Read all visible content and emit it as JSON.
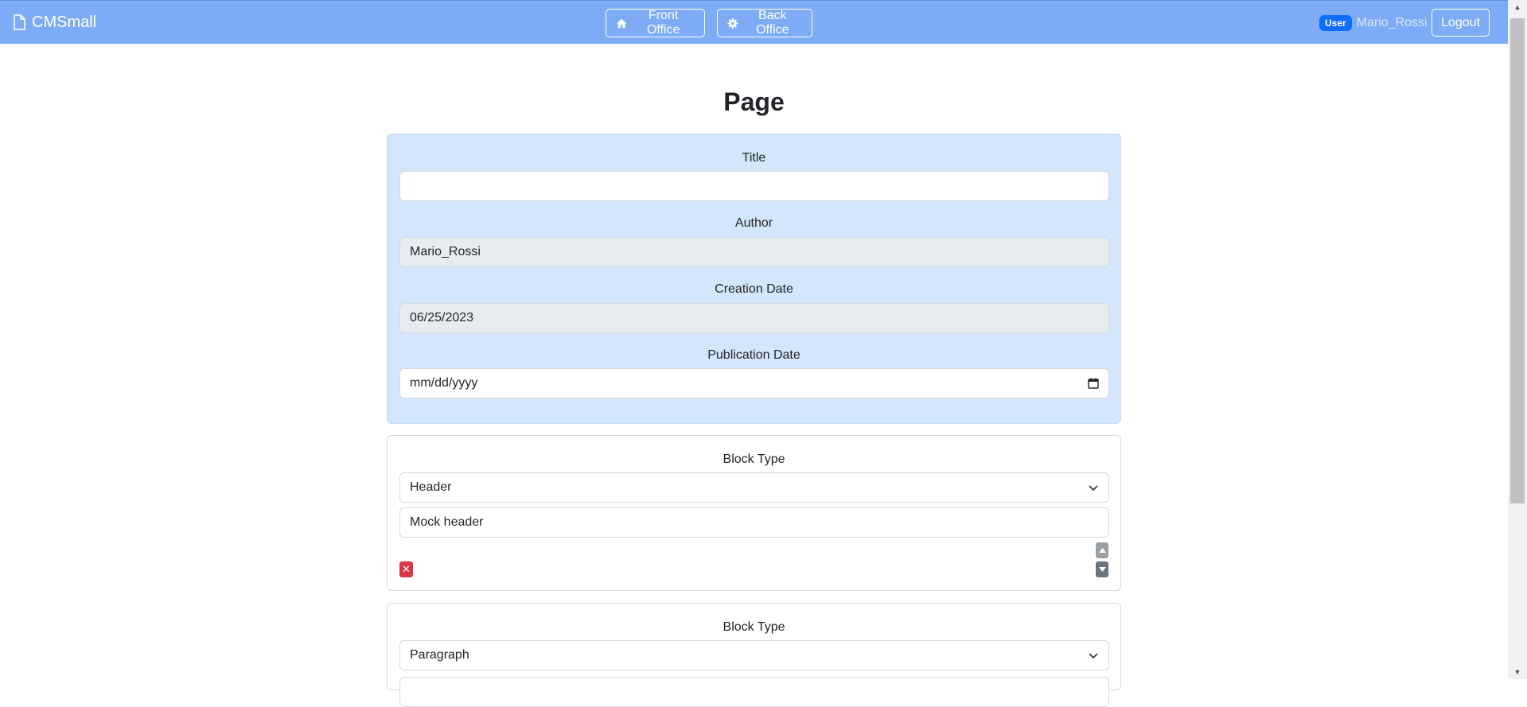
{
  "app": {
    "brand": "CMSmall"
  },
  "nav": {
    "front_office": "Front Office",
    "back_office": "Back Office"
  },
  "user": {
    "badge": "User",
    "name": "Mario_Rossi",
    "logout": "Logout"
  },
  "page": {
    "title": "Page"
  },
  "form": {
    "title_label": "Title",
    "title_value": "",
    "author_label": "Author",
    "author_value": "Mario_Rossi",
    "creation_label": "Creation Date",
    "creation_value": "06/25/2023",
    "publication_label": "Publication Date",
    "publication_placeholder": "mm/dd/yyyy"
  },
  "blocks": [
    {
      "type_label": "Block Type",
      "type_value": "Header",
      "content": "Mock header"
    },
    {
      "type_label": "Block Type",
      "type_value": "Paragraph"
    }
  ],
  "colors": {
    "navbar": "#7eabf5",
    "meta_panel": "#d4e6fb",
    "badge": "#0d6efd",
    "delete": "#dc3545"
  }
}
